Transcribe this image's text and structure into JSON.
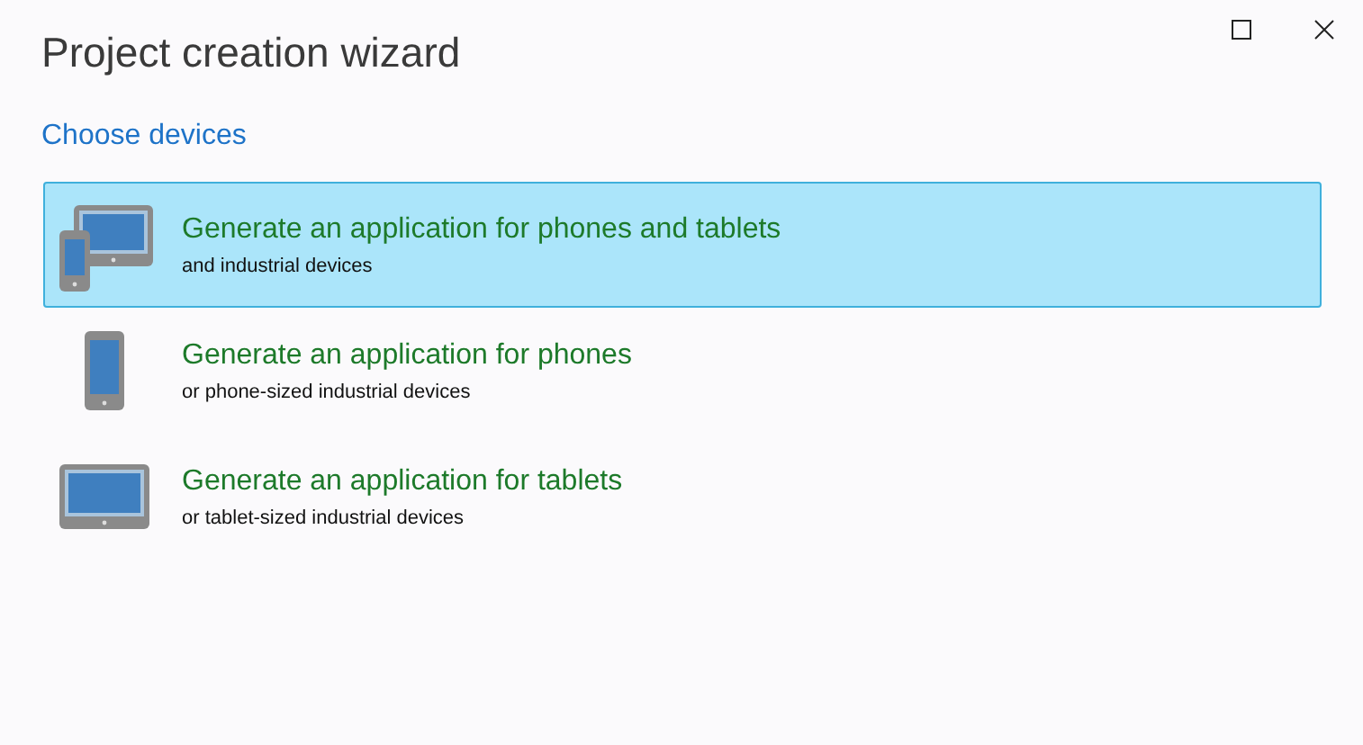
{
  "window": {
    "title": "Project creation wizard"
  },
  "section": {
    "heading": "Choose devices"
  },
  "options": [
    {
      "kind": "both",
      "title": "Generate an application for phones and tablets",
      "subtitle": "and industrial devices",
      "selected": true
    },
    {
      "kind": "phone",
      "title": "Generate an application for phones",
      "subtitle": "or phone-sized industrial devices",
      "selected": false
    },
    {
      "kind": "tablet",
      "title": "Generate an application for tablets",
      "subtitle": "or tablet-sized industrial devices",
      "selected": false
    }
  ]
}
